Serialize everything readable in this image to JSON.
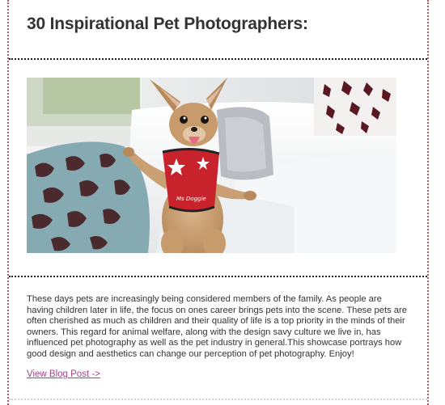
{
  "post": {
    "title": "30 Inspirational Pet Photographers:",
    "image": {
      "subject": "chihuahua-in-red-star-harness",
      "harness_text": "Ms Doggie"
    },
    "body": "These days pets are increasingly being considered members of the family. As people are having children later in life, the focus on ones career brings pets into the scene. These pets are often cherished as much as children and their quality of life is a top priority in the minds of their owners. This regard for animal welfare, along with the design savy culture we live in, has influenced pet photography as well as the pet industry in general.This showcase portrays how good design and aesthetics can change our perception of pet photography. Enjoy!",
    "link_label": "View Blog Post ->"
  },
  "colors": {
    "border_dots": "#b65a6a",
    "separator": "#222222",
    "link": "#a3438a",
    "text": "#333333"
  }
}
